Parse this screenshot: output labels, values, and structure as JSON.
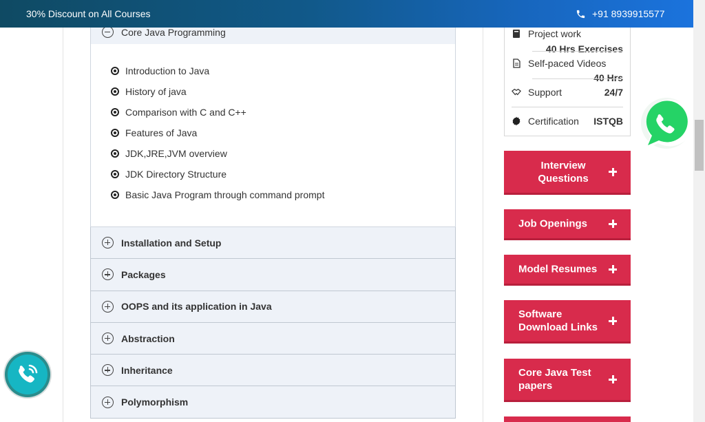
{
  "topbar": {
    "promo_text": "30% Discount on All Courses",
    "phone_icon": "phone-icon",
    "phone_number": "+91 8939915577"
  },
  "curriculum": {
    "open_module": "Core Java Programming",
    "topics": [
      "Introduction to Java",
      "History of java",
      "Comparison with C and C++",
      "Features of Java",
      "JDK,JRE,JVM overview",
      "JDK Directory Structure",
      "Basic Java Program through command prompt"
    ],
    "modules": [
      "Installation and Setup",
      "Packages",
      "OOPS and its application in Java",
      "Abstraction",
      "Inheritance",
      "Polymorphism"
    ]
  },
  "course_info": {
    "project_work_label": "Project work",
    "project_work_value": "40 Hrs Exercises",
    "videos_label": "Self-paced Videos",
    "videos_value": "40 Hrs",
    "support_label": "Support",
    "support_value": "24/7",
    "cert_label": "Certification",
    "cert_value": "ISTQB"
  },
  "sidebar_buttons": {
    "interview": "Interview Questions",
    "jobs": "Job Openings",
    "resumes": "Model Resumes",
    "downloads": "Software Download Links",
    "test_papers": "Core Java Test papers"
  },
  "colors": {
    "topbar_start": "#0f4a63",
    "topbar_end": "#1b73dd",
    "button_red": "#d82b4c",
    "accordion_bg": "#eef2f8",
    "whatsapp_green": "#25d366",
    "call_teal": "#16b6c3"
  }
}
